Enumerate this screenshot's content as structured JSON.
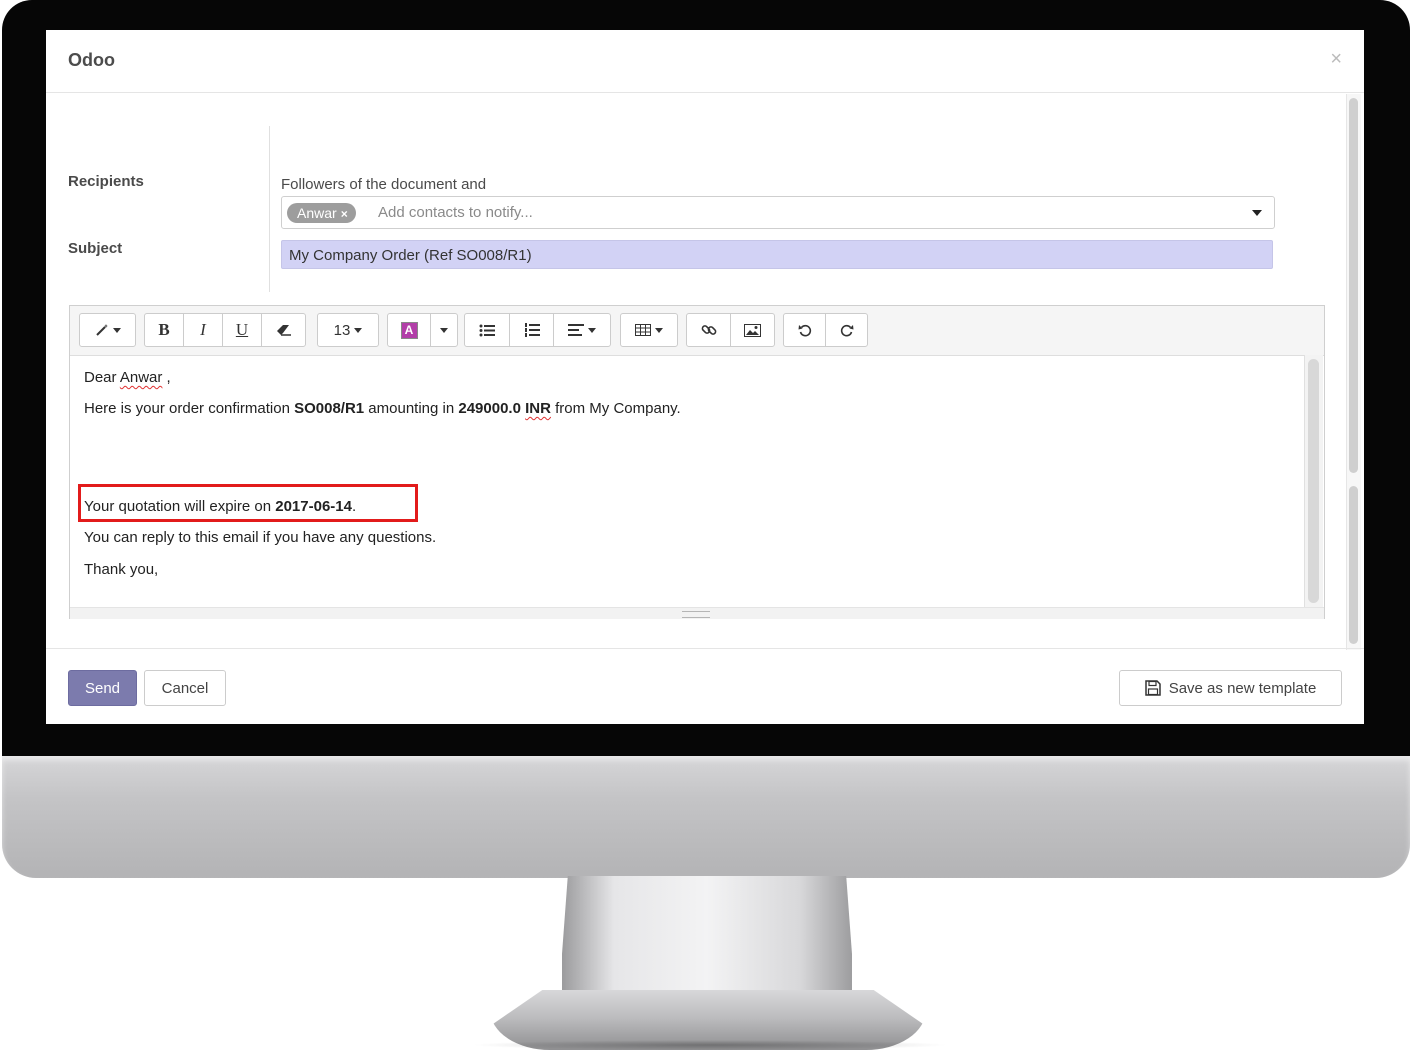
{
  "dialog": {
    "title": "Odoo",
    "close_glyph": "×"
  },
  "recipients": {
    "label": "Recipients",
    "followers_text": "Followers of the document and",
    "tag_label": "Anwar",
    "tag_remove_glyph": "×",
    "placeholder": "Add contacts to notify..."
  },
  "subject": {
    "label": "Subject",
    "value": "My Company Order (Ref SO008/R1)"
  },
  "toolbar": {
    "style_icon": "magic-wand-icon",
    "bold": "B",
    "italic": "I",
    "underline": "U",
    "eraser_icon": "eraser-icon",
    "font_size": "13",
    "font_color": "A",
    "font_color_accent": "#b23ea8",
    "unordered_list_icon": "unordered-list-icon",
    "ordered_list_icon": "ordered-list-icon",
    "align_icon": "align-left-icon",
    "table_icon": "table-icon",
    "link_icon": "link-icon",
    "image_icon": "image-icon",
    "undo_icon": "undo-icon",
    "redo_icon": "redo-icon"
  },
  "body": {
    "greeting_prefix": "Dear ",
    "greeting_name": "Anwar",
    "greeting_suffix": " ,",
    "line2_a": "Here is your order confirmation ",
    "line2_order": "SO008/R1",
    "line2_b": " amounting in ",
    "line2_amount": "249000.0",
    "line2_currency": "INR",
    "line2_c": " from My Company.",
    "expire_a": "Your quotation will expire on ",
    "expire_date": "2017-06-14",
    "expire_b": ".",
    "reply_line": "You can reply to this email if you have any questions.",
    "thanks_line": "Thank you,"
  },
  "footer": {
    "send_label": "Send",
    "cancel_label": "Cancel",
    "save_template_label": "Save as new template"
  },
  "colors": {
    "send_button": "#7c7bad",
    "subject_highlight": "#d2d2f5",
    "highlight_border": "#e21b1b"
  }
}
